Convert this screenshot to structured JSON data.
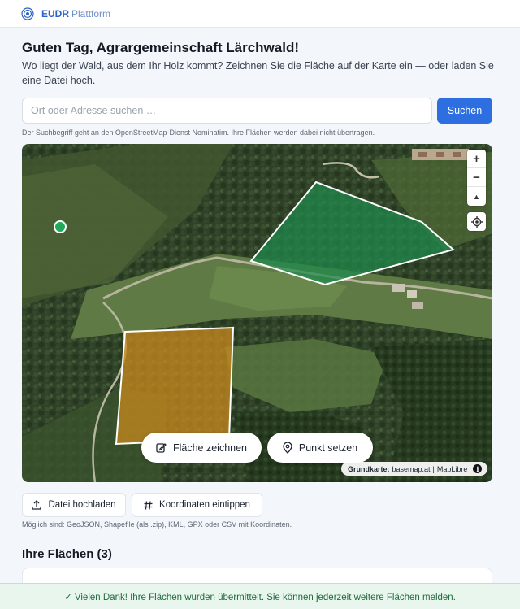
{
  "header": {
    "brand_strong": "EUDR",
    "brand_light": "Plattform",
    "icon": "target-rings-icon"
  },
  "greeting": "Guten Tag, Agrargemeinschaft Lärchwald!",
  "intro": "Wo liegt der Wald, aus dem Ihr Holz kommt? Zeichnen Sie die Fläche auf der Karte ein — oder laden Sie eine Datei hoch.",
  "search": {
    "placeholder": "Ort oder Adresse suchen …",
    "value": "",
    "button_label": "Suchen"
  },
  "search_hint": "Der Suchbegriff geht an den OpenStreetMap-Dienst Nominatim. Ihre Flächen werden dabei nicht übertragen.",
  "map": {
    "controls": {
      "zoom_in": "+",
      "zoom_out": "−",
      "compass": "▲"
    },
    "draw_area_label": "Fläche zeichnen",
    "set_point_label": "Punkt setzen",
    "attribution": {
      "prefix": "Grundkarte:",
      "source": "basemap.at",
      "separator": "|",
      "engine": "MapLibre"
    },
    "colors": {
      "polygon_green": "#1f8a4c",
      "polygon_orange": "#c98a1e",
      "marker": "#1faa59"
    }
  },
  "upload_button": "Datei hochladen",
  "coordinates_button": "Koordinaten eintippen",
  "formats_hint": "Möglich sind: GeoJSON, Shapefile (als .zip), KML, GPX oder CSV mit Koordinaten.",
  "areas": {
    "title": "Ihre Flächen (3)"
  },
  "toast": "✓ Vielen Dank! Ihre Flächen wurden übermittelt. Sie können jederzeit weitere Flächen melden.",
  "theme": {
    "accent": "#2d6fe0",
    "success_bg": "#e9f6ee",
    "success_text": "#1f6b3d"
  }
}
